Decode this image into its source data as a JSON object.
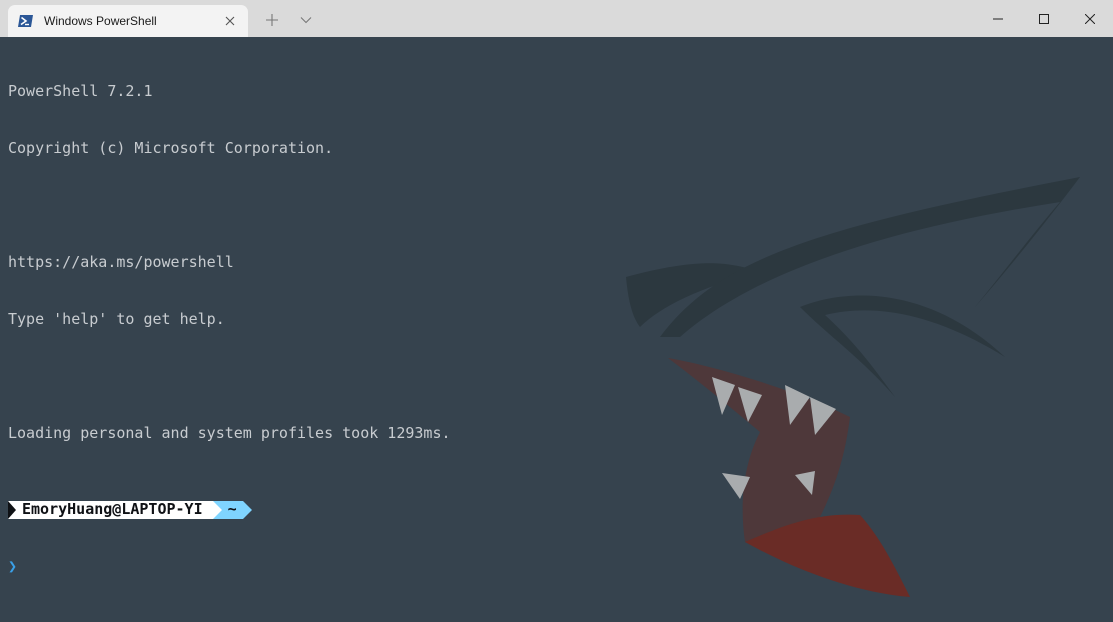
{
  "window": {
    "tab_title": "Windows PowerShell",
    "icons": {
      "tab": "powershell-icon",
      "close_tab": "close-icon",
      "new_tab": "plus-icon",
      "dropdown": "chevron-down-icon",
      "minimize": "minimize-icon",
      "maximize": "maximize-icon",
      "close": "close-icon"
    }
  },
  "terminal": {
    "lines": [
      "PowerShell 7.2.1",
      "Copyright (c) Microsoft Corporation.",
      "",
      "https://aka.ms/powershell",
      "Type 'help' to get help.",
      "",
      "Loading personal and system profiles took 1293ms."
    ],
    "prompt": {
      "user_host": "EmoryHuang@LAPTOP-YI",
      "directory": "~",
      "caret": "❯"
    },
    "colors": {
      "background": "#36434e",
      "text": "#c8ccd0",
      "prompt_user_bg": "#ffffff",
      "prompt_dir_bg": "#7fd4ff",
      "caret": "#3aa0e8"
    },
    "background_image": "shark-artwork"
  }
}
